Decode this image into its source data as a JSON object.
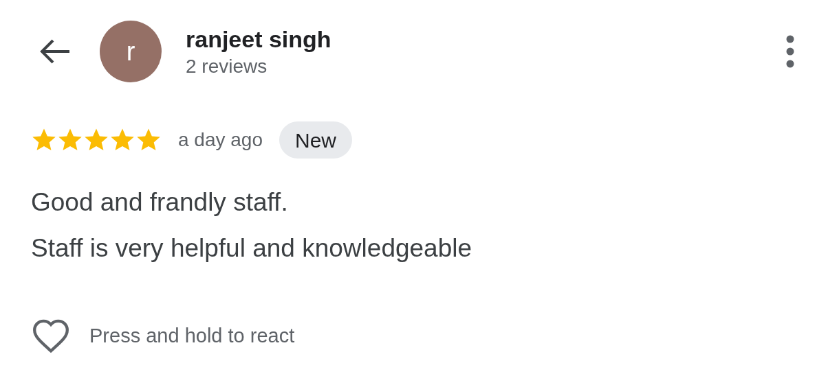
{
  "reviewer": {
    "initial": "r",
    "name": "ranjeet singh",
    "reviews": "2 reviews"
  },
  "review": {
    "stars": 5,
    "time": "a day ago",
    "badge": "New",
    "lines": [
      "Good and frandly staff.",
      "Staff is very helpful and knowledgeable"
    ]
  },
  "reaction": {
    "hint": "Press and hold to react"
  }
}
